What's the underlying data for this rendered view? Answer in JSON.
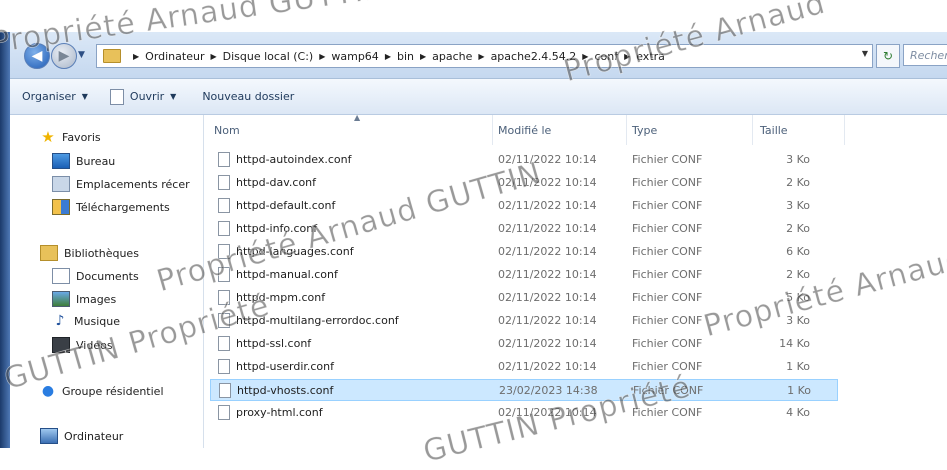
{
  "address": {
    "crumbs": [
      "Ordinateur",
      "Disque local (C:)",
      "wamp64",
      "bin",
      "apache",
      "apache2.4.54.2",
      "conf",
      "extra"
    ],
    "search_placeholder": "Recher"
  },
  "toolbar": {
    "organiser": "Organiser",
    "ouvrir": "Ouvrir",
    "nouveau_dossier": "Nouveau dossier"
  },
  "nav": {
    "favoris": "Favoris",
    "bureau": "Bureau",
    "emplacements": "Emplacements récer",
    "telechargements": "Téléchargements",
    "bibliotheques": "Bibliothèques",
    "documents": "Documents",
    "images": "Images",
    "musique": "Musique",
    "videos": "Vidéos",
    "groupe": "Groupe résidentiel",
    "ordinateur": "Ordinateur"
  },
  "columns": {
    "name": "Nom",
    "date": "Modifié le",
    "type": "Type",
    "size": "Taille"
  },
  "files": [
    {
      "name": "httpd-autoindex.conf",
      "date": "02/11/2022 10:14",
      "type": "Fichier CONF",
      "size": "3 Ko"
    },
    {
      "name": "httpd-dav.conf",
      "date": "02/11/2022 10:14",
      "type": "Fichier CONF",
      "size": "2 Ko"
    },
    {
      "name": "httpd-default.conf",
      "date": "02/11/2022 10:14",
      "type": "Fichier CONF",
      "size": "3 Ko"
    },
    {
      "name": "httpd-info.conf",
      "date": "02/11/2022 10:14",
      "type": "Fichier CONF",
      "size": "2 Ko"
    },
    {
      "name": "httpd-languages.conf",
      "date": "02/11/2022 10:14",
      "type": "Fichier CONF",
      "size": "6 Ko"
    },
    {
      "name": "httpd-manual.conf",
      "date": "02/11/2022 10:14",
      "type": "Fichier CONF",
      "size": "2 Ko"
    },
    {
      "name": "httpd-mpm.conf",
      "date": "02/11/2022 10:14",
      "type": "Fichier CONF",
      "size": "5 Ko"
    },
    {
      "name": "httpd-multilang-errordoc.conf",
      "date": "02/11/2022 10:14",
      "type": "Fichier CONF",
      "size": "3 Ko"
    },
    {
      "name": "httpd-ssl.conf",
      "date": "02/11/2022 10:14",
      "type": "Fichier CONF",
      "size": "14 Ko"
    },
    {
      "name": "httpd-userdir.conf",
      "date": "02/11/2022 10:14",
      "type": "Fichier CONF",
      "size": "1 Ko"
    },
    {
      "name": "httpd-vhosts.conf",
      "date": "23/02/2023 14:38",
      "type": "Fichier CONF",
      "size": "1 Ko"
    },
    {
      "name": "proxy-html.conf",
      "date": "02/11/2022 10:14",
      "type": "Fichier CONF",
      "size": "4 Ko"
    }
  ],
  "selected_file": "httpd-vhosts.conf",
  "watermark": {
    "text_1": "Propriété Arnaud GUTTIN",
    "text_2": "Propriété Arnaud GUTTIN",
    "text_3": "Propriété Arnaud",
    "text_4": "GUTTIN Propriété",
    "text_5": "Propriété Arnaud",
    "text_6": "GUTTIN Propriété"
  }
}
